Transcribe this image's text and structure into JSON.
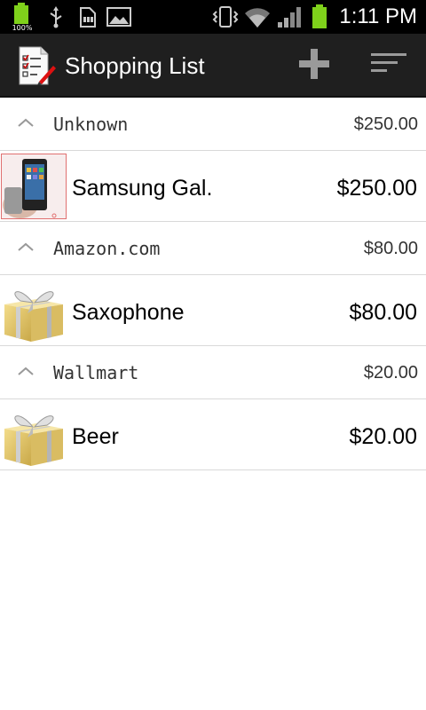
{
  "status_bar": {
    "battery_percent": "100%",
    "time": "1:11 PM",
    "icons": [
      "battery-charging-icon",
      "usb-icon",
      "sd-card-icon",
      "picture-icon",
      "vibrate-icon",
      "wifi-icon",
      "signal-icon",
      "battery-icon"
    ]
  },
  "action_bar": {
    "title": "Shopping List",
    "app_icon": "checklist-pencil-icon",
    "add_icon": "plus-icon",
    "sort_icon": "sort-icon"
  },
  "groups": [
    {
      "name": "Unknown",
      "total": "$250.00",
      "items": [
        {
          "name": "Samsung Gal.",
          "price": "$250.00",
          "thumb": "phone-photo"
        }
      ]
    },
    {
      "name": "Amazon.com",
      "total": "$80.00",
      "items": [
        {
          "name": "Saxophone",
          "price": "$80.00",
          "thumb": "gift-box-icon"
        }
      ]
    },
    {
      "name": "Wallmart",
      "total": "$20.00",
      "items": [
        {
          "name": "Beer",
          "price": "$20.00",
          "thumb": "gift-box-icon"
        }
      ]
    }
  ],
  "colors": {
    "status_bar_bg": "#000000",
    "action_bar_bg": "#1f1f1f",
    "battery_green": "#7fd11b",
    "divider": "#d9d9d9"
  }
}
